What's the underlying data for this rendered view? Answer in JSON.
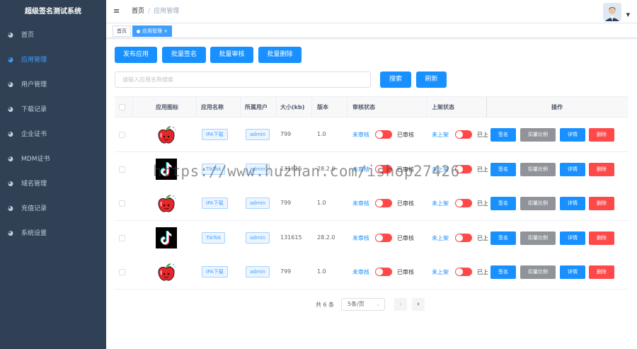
{
  "app_title": "超级签名测试系统",
  "sidebar": {
    "items": [
      {
        "label": "首页",
        "active": false
      },
      {
        "label": "应用管理",
        "active": true
      },
      {
        "label": "用户管理",
        "active": false
      },
      {
        "label": "下载记录",
        "active": false
      },
      {
        "label": "企业证书",
        "active": false
      },
      {
        "label": "MDM证书",
        "active": false
      },
      {
        "label": "域名管理",
        "active": false
      },
      {
        "label": "充值记录",
        "active": false
      },
      {
        "label": "系统设置",
        "active": false
      }
    ]
  },
  "header": {
    "breadcrumb_home": "首页",
    "breadcrumb_sep": "/",
    "breadcrumb_current": "应用管理"
  },
  "tags": [
    {
      "label": "首页"
    },
    {
      "label": "应用管理"
    }
  ],
  "tag_close": "×",
  "toolbar": {
    "publish": "发布应用",
    "batch_sign": "批量签名",
    "batch_review": "批量审核",
    "batch_delete": "批量删除"
  },
  "search": {
    "placeholder": "请输入应用名称搜索",
    "search_btn": "搜索",
    "refresh_btn": "刷新"
  },
  "table": {
    "headers": [
      "应用图标",
      "应用名称",
      "所属用户",
      "大小(kb)",
      "版本",
      "审核状态",
      "上架状态",
      "操作"
    ],
    "rows": [
      {
        "icon": "apple-icon",
        "name": "IPA下载",
        "user": "admin",
        "size": "799",
        "version": "1.0",
        "review_left": "未审核",
        "review_right": "已审核",
        "shelf_left": "未上架",
        "shelf_right": "已上"
      },
      {
        "icon": "tiktok-icon",
        "name": "TikTok",
        "user": "admin",
        "size": "131615",
        "version": "28.2.0",
        "review_left": "未审核",
        "review_right": "已审核",
        "shelf_left": "未上架",
        "shelf_right": "已上"
      },
      {
        "icon": "apple-icon",
        "name": "IPA下载",
        "user": "admin",
        "size": "799",
        "version": "1.0",
        "review_left": "未审核",
        "review_right": "已审核",
        "shelf_left": "未上架",
        "shelf_right": "已上"
      },
      {
        "icon": "tiktok-icon",
        "name": "TikTok",
        "user": "admin",
        "size": "131615",
        "version": "28.2.0",
        "review_left": "未审核",
        "review_right": "已审核",
        "shelf_left": "未上架",
        "shelf_right": "已上"
      },
      {
        "icon": "apple-icon",
        "name": "IPA下载",
        "user": "admin",
        "size": "799",
        "version": "1.0",
        "review_left": "未审核",
        "review_right": "已审核",
        "shelf_left": "未上架",
        "shelf_right": "已上"
      }
    ],
    "actions": {
      "sign": "签名",
      "ratio": "扣量比例",
      "detail": "详情",
      "delete": "删除"
    }
  },
  "pagination": {
    "total": "共 6 条",
    "page_size": "5条/页",
    "prev": "‹",
    "next": "›"
  },
  "watermark": "https://www.huzhan.com/ishop27426",
  "colors": {
    "sidebar_bg": "#304156",
    "primary": "#1890ff",
    "danger": "#ff4949",
    "gray": "#909399"
  }
}
